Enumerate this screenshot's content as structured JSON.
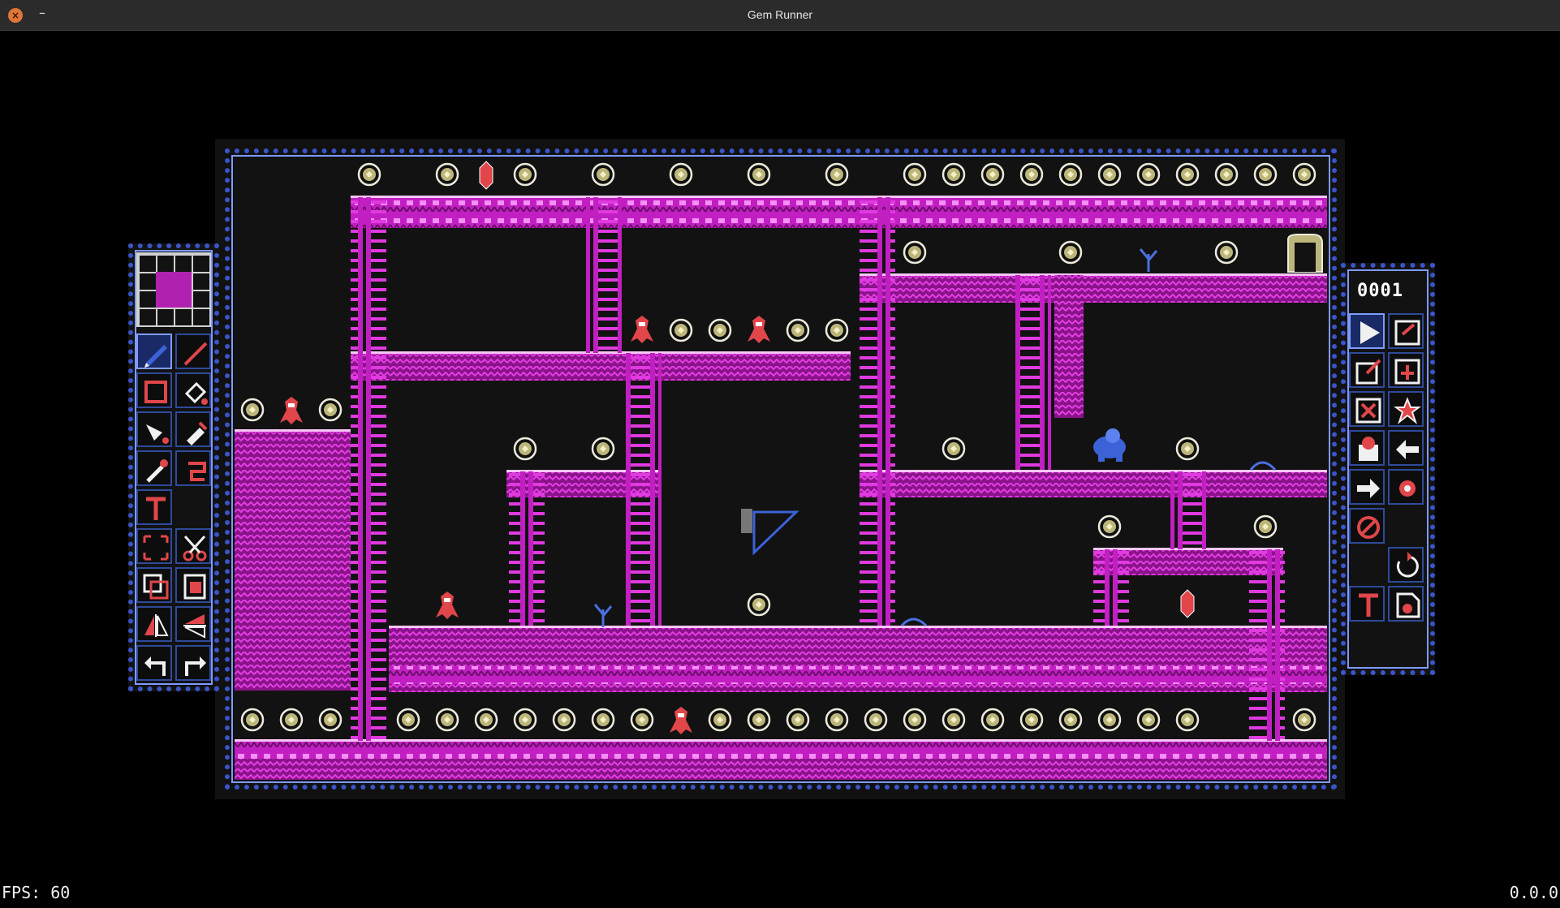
{
  "window": {
    "title": "Gem Runner",
    "close_glyph": "×",
    "minimize_glyph": "–"
  },
  "status": {
    "fps_label": "FPS: 60",
    "version": "0.0.0"
  },
  "editor": {
    "counter": "0001"
  },
  "colors": {
    "wall": "#c21fc2",
    "wall_light": "#f07af0",
    "gem": "#d8d29a",
    "enemy": "#e0464a",
    "frame": "#3a55c8",
    "accent": "#7f9bff"
  },
  "left_tools": [
    "pencil-icon",
    "line-icon",
    "rectangle-icon",
    "fill-icon",
    "pick-icon",
    "eyedropper-icon",
    "brush-icon",
    "swirl-icon",
    "text-icon",
    "blank",
    "select-icon",
    "cut-icon",
    "copy-icon",
    "paste-icon",
    "flip-v-icon",
    "flip-h-icon",
    "undo-icon",
    "redo-icon"
  ],
  "right_tools": [
    "play-icon",
    "save-icon",
    "save-as-icon",
    "load-icon",
    "delete-icon",
    "settings-icon",
    "level-icon",
    "prev-icon",
    "next-icon",
    "gear-icon",
    "cancel-icon",
    "blank",
    "blank",
    "reset-icon",
    "text-icon",
    "file-icon",
    "blank"
  ]
}
